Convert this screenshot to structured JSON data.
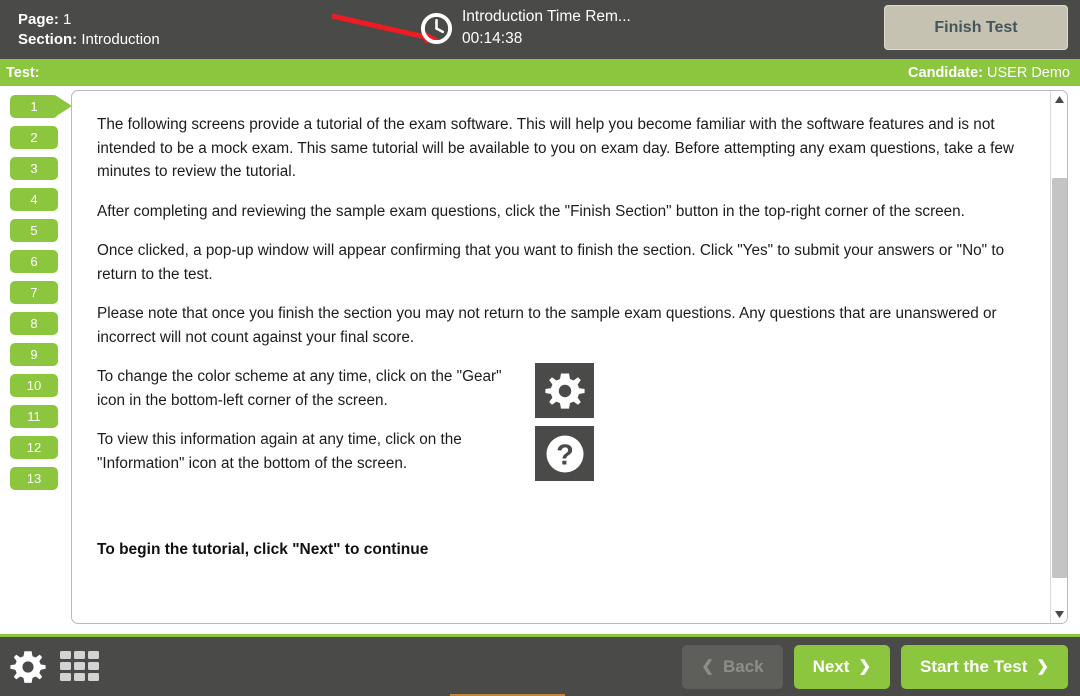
{
  "header": {
    "page_label": "Page:",
    "page_value": "1",
    "section_label": "Section:",
    "section_value": "Introduction",
    "timer_label": "Introduction Time Rem...",
    "timer_value": "00:14:38",
    "finish_test_label": "Finish Test",
    "clock_icon": "clock-icon",
    "annotation_arrow": "red-pointer-arrow"
  },
  "test_bar": {
    "test_label": "Test:",
    "test_value": "",
    "candidate_label": "Candidate:",
    "candidate_value": "USER Demo"
  },
  "nav_rail": {
    "items": [
      {
        "label": "1",
        "active": true
      },
      {
        "label": "2",
        "active": false
      },
      {
        "label": "3",
        "active": false
      },
      {
        "label": "4",
        "active": false
      },
      {
        "label": "5",
        "active": false
      },
      {
        "label": "6",
        "active": false
      },
      {
        "label": "7",
        "active": false
      },
      {
        "label": "8",
        "active": false
      },
      {
        "label": "9",
        "active": false
      },
      {
        "label": "10",
        "active": false
      },
      {
        "label": "11",
        "active": false
      },
      {
        "label": "12",
        "active": false
      },
      {
        "label": "13",
        "active": false
      }
    ]
  },
  "content": {
    "paragraphs": [
      "The following screens provide a tutorial of the exam software. This will help you become familiar with the software features and is not intended to be a mock exam. This same tutorial will be available to you on exam day. Before attempting any exam questions, take a few minutes to review the tutorial.",
      "After completing and reviewing the sample exam questions, click the \"Finish Section\" button in the top-right corner of the screen.",
      "Once clicked, a pop-up window will appear confirming that you want to finish the section. Click \"Yes\" to submit your answers or \"No\" to return to the test.",
      "Please note that once you finish the section you may not return to the sample exam questions. Any questions that are unanswered or incorrect will not count against your final score."
    ],
    "gear_note": "To change the color scheme at any time, click on the \"Gear\" icon in the bottom-left corner of the screen.",
    "gear_icon": "gear-icon",
    "info_note": "To view this information again at any time, click on the \"Information\" icon at the bottom of the screen.",
    "info_icon": "question-mark-icon",
    "closing_line": "To begin the tutorial, click \"Next\" to continue"
  },
  "scrollbar": {
    "up_icon": "scroll-up-arrow-icon",
    "down_icon": "scroll-down-arrow-icon"
  },
  "footer": {
    "settings_icon": "gear-icon",
    "grid_icon": "grid-menu-icon",
    "back_label": "Back",
    "next_label": "Next",
    "start_label": "Start the Test",
    "back_chevron": "❮",
    "next_chevron": "❯",
    "start_chevron": "❯"
  },
  "colors": {
    "green": "#8cc63e",
    "dark": "#4a4a48",
    "beige": "#c6c2b1",
    "arrow_red": "#ee1c22"
  }
}
